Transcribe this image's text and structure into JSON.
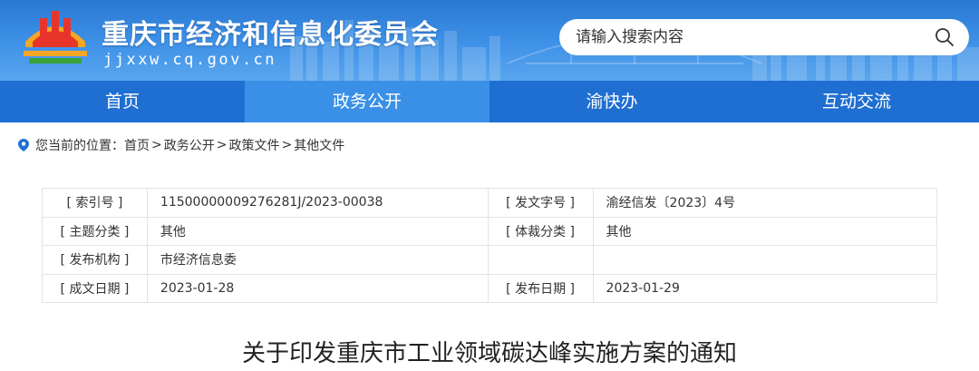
{
  "header": {
    "site_title": "重庆市经济和信息化委员会",
    "site_domain": "jjxxw.cq.gov.cn",
    "search_placeholder": "请输入搜索内容",
    "search_icon": "search-icon"
  },
  "colors": {
    "header_blue": "#3f92e8",
    "nav_blue": "#1f6fd2",
    "nav_active": "#3a8fe6",
    "logo_red": "#e8352b",
    "logo_orange": "#f5a623",
    "logo_green": "#3aa33a"
  },
  "nav": {
    "items": [
      {
        "label": "首页",
        "active": false
      },
      {
        "label": "政务公开",
        "active": true
      },
      {
        "label": "渝快办",
        "active": false
      },
      {
        "label": "互动交流",
        "active": false
      }
    ]
  },
  "breadcrumb": {
    "prefix": "您当前的位置：",
    "items": [
      "首页",
      "政务公开",
      "政策文件",
      "其他文件"
    ],
    "separator": " >"
  },
  "info": {
    "rows": [
      {
        "label1": "[ 索引号 ]",
        "value1": "11500000009276281J/2023-00038",
        "label2": "[ 发文字号 ]",
        "value2": "渝经信发〔2023〕4号"
      },
      {
        "label1": "[ 主题分类 ]",
        "value1": "其他",
        "label2": "[ 体裁分类 ]",
        "value2": "其他"
      },
      {
        "label1": "[ 发布机构 ]",
        "value1": "市经济信息委",
        "label2": "",
        "value2": ""
      },
      {
        "label1": "[ 成文日期 ]",
        "value1": "2023-01-28",
        "label2": "[ 发布日期 ]",
        "value2": "2023-01-29"
      }
    ]
  },
  "document": {
    "title": "关于印发重庆市工业领域碳达峰实施方案的通知"
  }
}
